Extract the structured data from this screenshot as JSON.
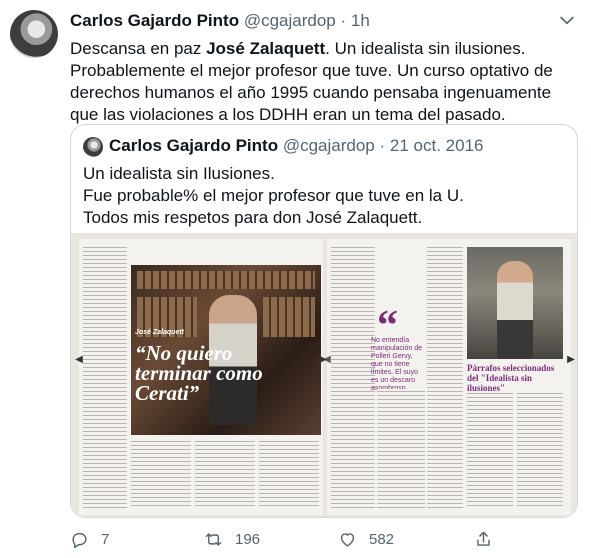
{
  "tweet": {
    "author_name": "Carlos Gajardo Pinto",
    "author_handle": "@cgajardop",
    "separator": "·",
    "time": "1h",
    "text_before": "Descansa en paz ",
    "text_bold": "José Zalaquett",
    "text_after": ". Un idealista sin ilusiones. Probablemente el mejor profesor que tuve. Un curso optativo de derechos humanos el año 1995 cuando pensaba ingenuamente que las violaciones a los DDHH eran un tema del pasado."
  },
  "quoted": {
    "author_name": "Carlos Gajardo Pinto",
    "author_handle": "@cgajardop",
    "separator": "·",
    "time": "21 oct. 2016",
    "lines": [
      "Un idealista sin Ilusiones.",
      "Fue probable% el mejor profesor que tuve en la U.",
      "Todos mis respetos para don José Zalaquett."
    ],
    "media": {
      "left_page": {
        "kicker": "José Zalaquett",
        "headline": "“No quiero terminar como Cerati”"
      },
      "right_page": {
        "pull_quote": "No entendía manipulación de Polleri Gervy, que no tiene límites. El suyo es un descaro asombroso",
        "subhead": "Párrafos seleccionados del \"Idealista sin ilusiones\""
      }
    }
  },
  "actions": {
    "reply_count": "7",
    "retweet_count": "196",
    "like_count": "582"
  },
  "colors": {
    "text": "#0f1419",
    "secondary": "#536471",
    "border": "#cfd9de",
    "magazine_accent": "#7b2b7a"
  },
  "icons": [
    "chevron-down-icon",
    "reply-icon",
    "retweet-icon",
    "like-icon",
    "share-icon",
    "chevron-left-icon",
    "chevron-right-icon"
  ]
}
